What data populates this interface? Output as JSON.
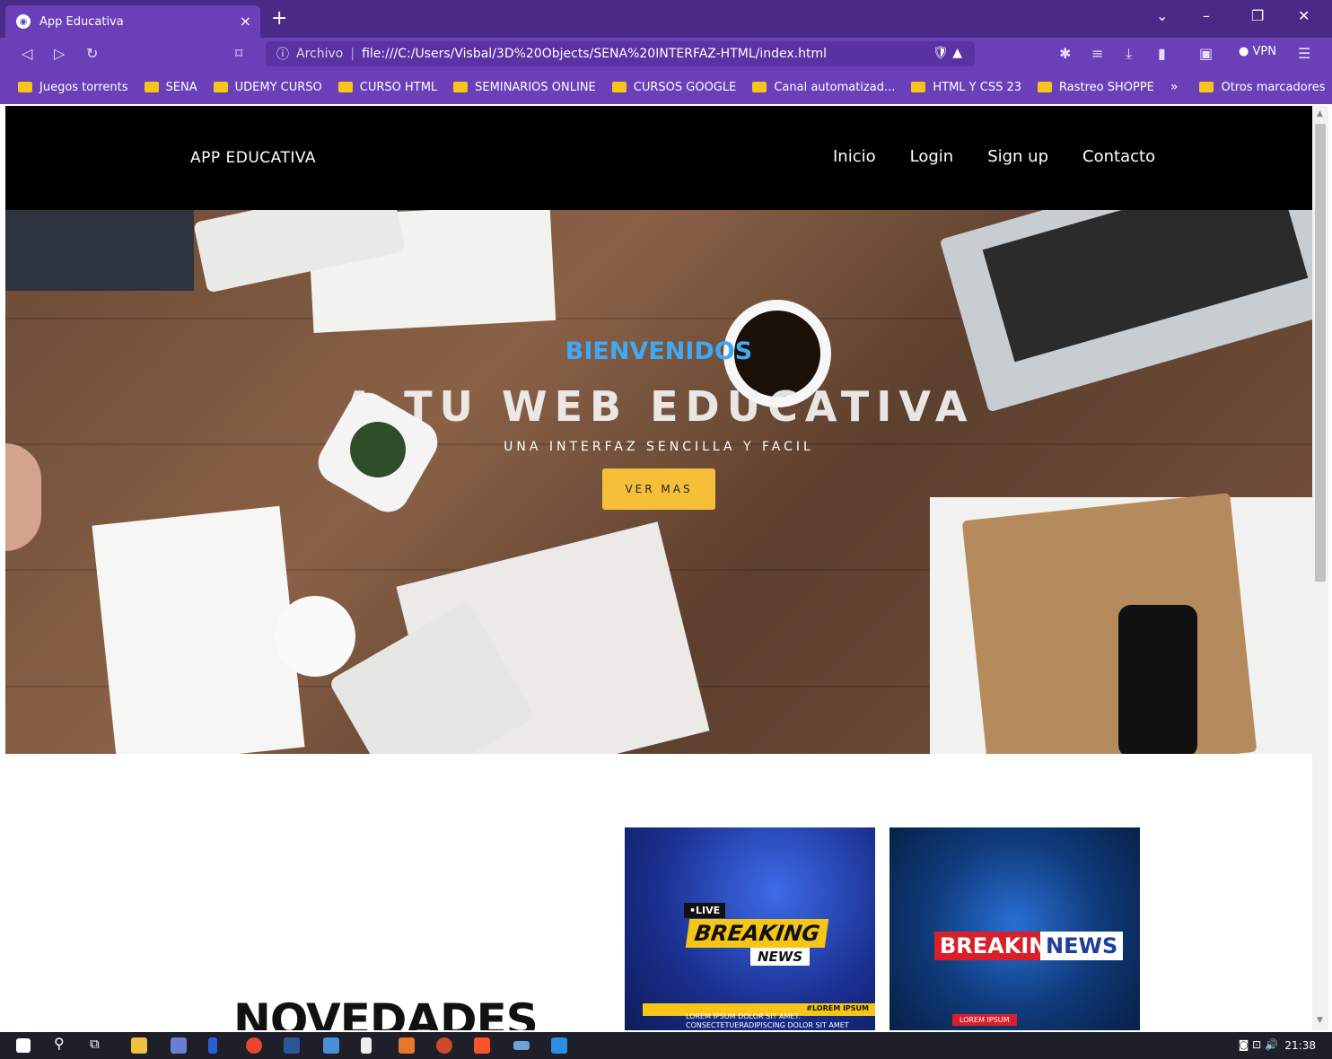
{
  "browser": {
    "tab_title": "App Educativa",
    "tab_close": "×",
    "new_tab": "+",
    "address_label": "Archivo",
    "address_url": "file:///C:/Users/Visbal/3D%20Objects/SENA%20INTERFAZ-HTML/index.html",
    "vpn_label": "VPN",
    "bookmarks": [
      "Juegos torrents",
      "SENA",
      "UDEMY CURSO",
      "CURSO HTML",
      "SEMINARIOS ONLINE",
      "CURSOS GOOGLE",
      "Canal automatizad...",
      "HTML Y CSS 23",
      "Rastreo SHOPPE"
    ],
    "bookmarks_more": "»",
    "other_bookmarks": "Otros marcadores"
  },
  "site": {
    "brand": "APP EDUCATIVA",
    "nav": [
      "Inicio",
      "Login",
      "Sign up",
      "Contacto"
    ],
    "hero": {
      "small_title": "BIENVENIDOS",
      "title": "A TU WEB EDUCATIVA",
      "subtitle": "UNA INTERFAZ SENCILLA Y FACIL",
      "button": "VER MAS"
    },
    "section_title": "NOVEDADES",
    "card1": {
      "live": "•LIVE",
      "breaking": "BREAKING",
      "news": "NEWS",
      "tag": "#LOREM IPSUM",
      "lorem": "LOREM IPSUM DOLOR SIT AMET. CONSECTETUERADIPISCING DOLOR SIT AMET"
    },
    "card2": {
      "breaking": "BREAKING",
      "news": "NEWS",
      "tag": "LOREM IPSUM"
    }
  },
  "taskbar": {
    "clock": "21:38"
  },
  "colors": {
    "browser_purple": "#6b3fb8",
    "accent_blue": "#3fa9f5",
    "button_yellow": "#f5bf3a"
  }
}
